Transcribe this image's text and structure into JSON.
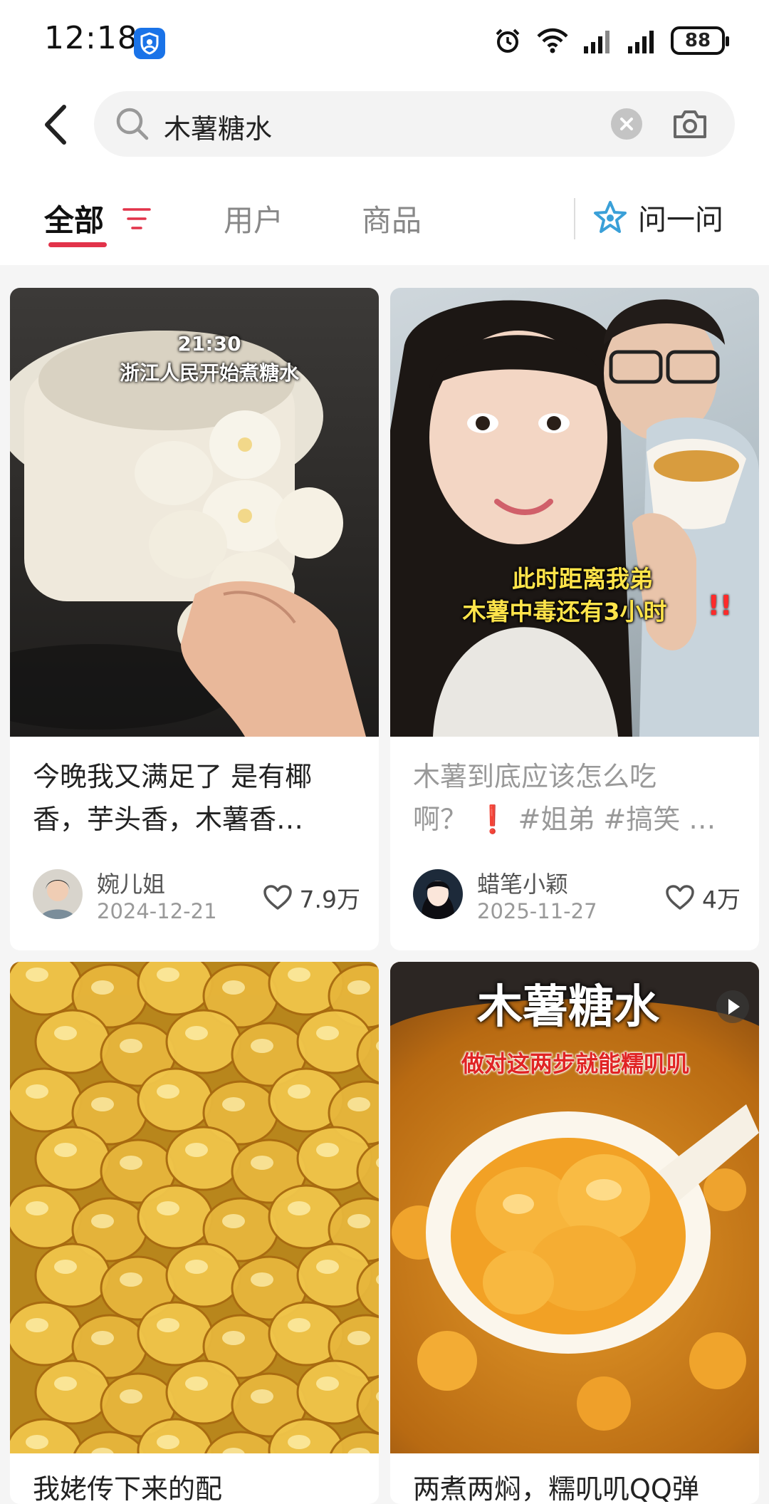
{
  "status": {
    "time": "12:18",
    "battery": "88"
  },
  "search": {
    "query": "木薯糖水"
  },
  "tabs": {
    "all": "全部",
    "users": "用户",
    "products": "商品",
    "ask": "问一问"
  },
  "colors": {
    "accent": "#e2334a",
    "ask_icon": "#3aa0d8"
  },
  "posts": [
    {
      "overlay_time": "21:30",
      "overlay_caption": "浙江人民开始煮糖水",
      "title_line1": "今晚我又满足了 是有椰",
      "title_line2": "香，芋头香，木薯香…",
      "author": "婉儿姐",
      "date": "2024-12-21",
      "likes": "7.9万"
    },
    {
      "overlay_line1": "此时距离我弟",
      "overlay_line2": "木薯中毒还有3小时",
      "overlay_marks": "!!",
      "title_line1": "木薯到底应该怎么吃",
      "title_line2": "啊？ ❗ #姐弟 #搞笑 …",
      "author": "蜡笔小颖",
      "date": "2025-11-27",
      "likes": "4万"
    },
    {
      "title_line1": "我姥传下来的配"
    },
    {
      "overlay_title": "木薯糖水",
      "overlay_subtitle": "做对这两步就能糯叽叽",
      "title_line1": "两煮两焖，糯叽叽QQ弹"
    }
  ]
}
